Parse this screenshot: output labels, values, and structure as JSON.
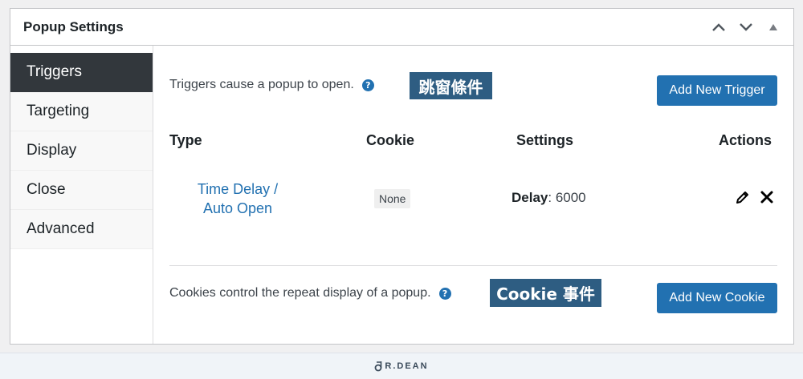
{
  "postbox": {
    "title": "Popup Settings"
  },
  "tabs": [
    {
      "label": "Triggers",
      "active": true
    },
    {
      "label": "Targeting",
      "active": false
    },
    {
      "label": "Display",
      "active": false
    },
    {
      "label": "Close",
      "active": false
    },
    {
      "label": "Advanced",
      "active": false
    }
  ],
  "triggers": {
    "description": "Triggers cause a popup to open.",
    "annotation": "跳窗條件",
    "add_button": "Add New Trigger",
    "columns": {
      "type": "Type",
      "cookie": "Cookie",
      "settings": "Settings",
      "actions": "Actions"
    },
    "rows": [
      {
        "type": "Time Delay / Auto Open",
        "cookie": "None",
        "setting_label": "Delay",
        "setting_value": ": 6000"
      }
    ]
  },
  "cookies": {
    "description": "Cookies control the repeat display of a popup.",
    "annotation": "Cookie 事件",
    "add_button": "Add New Cookie"
  },
  "footer": {
    "logo_text": "R.DEAN"
  },
  "colors": {
    "primary": "#2271b1",
    "active_tab": "#32373c",
    "annotation": "#2e5d82"
  }
}
